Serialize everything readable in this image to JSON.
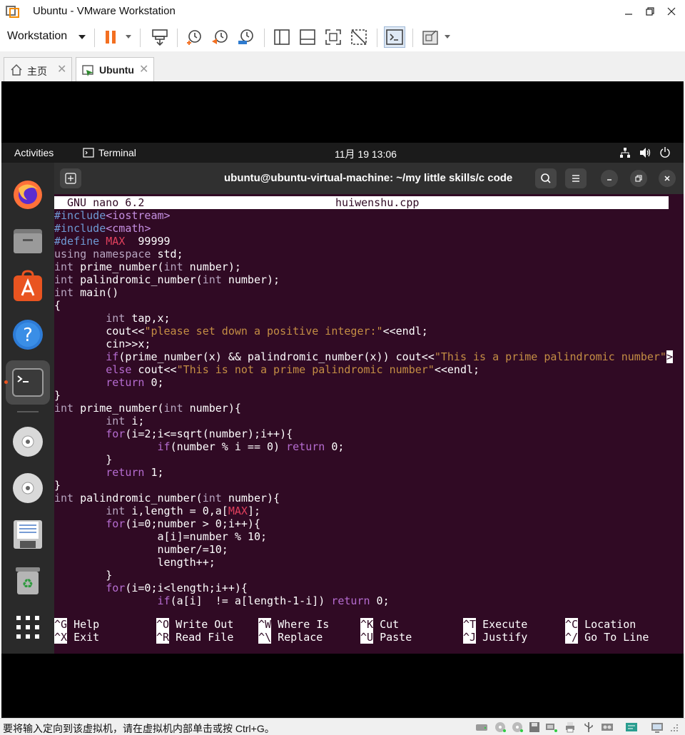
{
  "window": {
    "title": "Ubuntu - VMware Workstation"
  },
  "toolbar": {
    "workstation_menu": "Workstation"
  },
  "tabs": [
    {
      "label": "主页",
      "active": false
    },
    {
      "label": "Ubuntu",
      "active": true
    }
  ],
  "gnome": {
    "activities": "Activities",
    "app": "Terminal",
    "clock": "11月 19  13:06"
  },
  "terminal": {
    "title": "ubuntu@ubuntu-virtual-machine: ~/my little skills/c code"
  },
  "nano": {
    "version": "GNU nano 6.2",
    "filename": "huiwenshu.cpp",
    "code_lines": [
      [
        [
          "pp",
          "#include"
        ],
        [
          "inc",
          "<iostream>"
        ]
      ],
      [
        [
          "pp",
          "#include"
        ],
        [
          "inc",
          "<cmath>"
        ]
      ],
      [
        [
          "pp",
          "#define "
        ],
        [
          "mac",
          "MAX"
        ],
        [
          "",
          "  99999"
        ]
      ],
      [
        [
          "kw",
          "using namespace"
        ],
        [
          "",
          " std;"
        ]
      ],
      [
        [
          "kw",
          "int"
        ],
        [
          "",
          " prime_number("
        ],
        [
          "kw",
          "int"
        ],
        [
          "",
          " number);"
        ]
      ],
      [
        [
          "kw",
          "int"
        ],
        [
          "",
          " palindromic_number("
        ],
        [
          "kw",
          "int"
        ],
        [
          "",
          " number);"
        ]
      ],
      [
        [
          "kw",
          "int"
        ],
        [
          "",
          " main()"
        ]
      ],
      [
        [
          "",
          "{"
        ]
      ],
      [
        [
          "",
          "        "
        ],
        [
          "kw",
          "int"
        ],
        [
          "",
          " tap,x;"
        ]
      ],
      [
        [
          "",
          "        cout<<"
        ],
        [
          "str",
          "\"please set down a positive integer:\""
        ],
        [
          "",
          "<<endl;"
        ]
      ],
      [
        [
          "",
          "        cin>>x;"
        ]
      ],
      [
        [
          "",
          "        "
        ],
        [
          "ctl",
          "if"
        ],
        [
          "",
          "(prime_number(x) && palindromic_number(x)) cout<<"
        ],
        [
          "str",
          "\"This is a prime palindromic number\""
        ],
        [
          "trunc",
          ">"
        ]
      ],
      [
        [
          "",
          "        "
        ],
        [
          "ctl",
          "else"
        ],
        [
          "",
          " cout<<"
        ],
        [
          "str",
          "\"This is not a prime palindromic number\""
        ],
        [
          "",
          "<<endl;"
        ]
      ],
      [
        [
          "",
          "        "
        ],
        [
          "ctl",
          "return"
        ],
        [
          "",
          " 0;"
        ]
      ],
      [
        [
          "",
          "}"
        ]
      ],
      [
        [
          "kw",
          "int"
        ],
        [
          "",
          " prime_number("
        ],
        [
          "kw",
          "int"
        ],
        [
          "",
          " number){"
        ]
      ],
      [
        [
          "",
          "        "
        ],
        [
          "kw",
          "int"
        ],
        [
          "",
          " i;"
        ]
      ],
      [
        [
          "",
          "        "
        ],
        [
          "ctl",
          "for"
        ],
        [
          "",
          "(i=2;i<=sqrt(number);i++){"
        ]
      ],
      [
        [
          "",
          "                "
        ],
        [
          "ctl",
          "if"
        ],
        [
          "",
          "(number % i == 0) "
        ],
        [
          "ctl",
          "return"
        ],
        [
          "",
          " 0;"
        ]
      ],
      [
        [
          "",
          "        }"
        ]
      ],
      [
        [
          "",
          "        "
        ],
        [
          "ctl",
          "return"
        ],
        [
          "",
          " 1;"
        ]
      ],
      [
        [
          "",
          "}"
        ]
      ],
      [
        [
          "kw",
          "int"
        ],
        [
          "",
          " palindromic_number("
        ],
        [
          "kw",
          "int"
        ],
        [
          "",
          " number){"
        ]
      ],
      [
        [
          "",
          "        "
        ],
        [
          "kw",
          "int"
        ],
        [
          "",
          " i,length = 0,a["
        ],
        [
          "mac",
          "MAX"
        ],
        [
          "",
          "];"
        ]
      ],
      [
        [
          "",
          "        "
        ],
        [
          "ctl",
          "for"
        ],
        [
          "",
          "(i=0;number > 0;i++){"
        ]
      ],
      [
        [
          "",
          "                a[i]=number % 10;"
        ]
      ],
      [
        [
          "",
          "                number/=10;"
        ]
      ],
      [
        [
          "",
          "                length++;"
        ]
      ],
      [
        [
          "",
          "        }"
        ]
      ],
      [
        [
          "",
          "        "
        ],
        [
          "ctl",
          "for"
        ],
        [
          "",
          "(i=0;i<length;i++){"
        ]
      ],
      [
        [
          "",
          "                "
        ],
        [
          "ctl",
          "if"
        ],
        [
          "",
          "(a[i]  != a[length-1-i]) "
        ],
        [
          "ctl",
          "return"
        ],
        [
          "",
          " 0;"
        ]
      ]
    ],
    "shortcuts": [
      {
        "key": "^G",
        "label": "Help"
      },
      {
        "key": "^O",
        "label": "Write Out"
      },
      {
        "key": "^W",
        "label": "Where Is"
      },
      {
        "key": "^K",
        "label": "Cut"
      },
      {
        "key": "^T",
        "label": "Execute"
      },
      {
        "key": "^C",
        "label": "Location"
      },
      {
        "key": "^X",
        "label": "Exit"
      },
      {
        "key": "^R",
        "label": "Read File"
      },
      {
        "key": "^\\",
        "label": "Replace"
      },
      {
        "key": "^U",
        "label": "Paste"
      },
      {
        "key": "^J",
        "label": "Justify"
      },
      {
        "key": "^/",
        "label": "Go To Line"
      }
    ]
  },
  "statusbar": {
    "message": "要将输入定向到该虚拟机，请在虚拟机内部单击或按 Ctrl+G。"
  }
}
